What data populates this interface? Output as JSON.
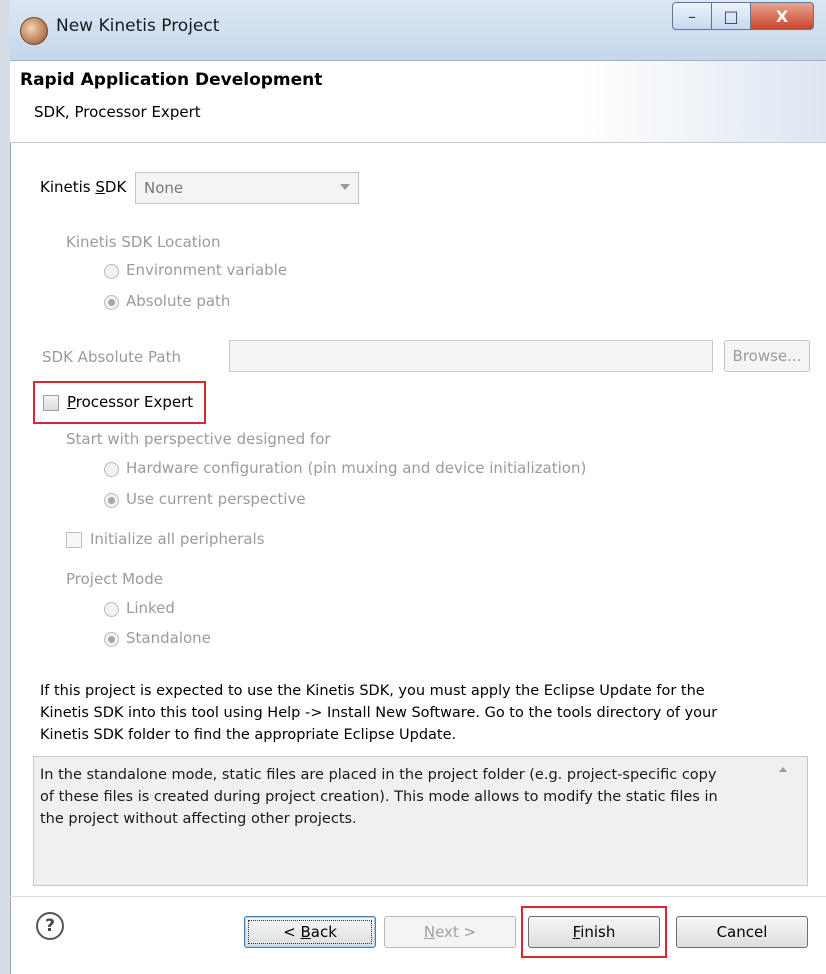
{
  "window": {
    "title": "New Kinetis Project",
    "controls": {
      "minimize": "–",
      "maximize": "□",
      "close": "X"
    }
  },
  "header": {
    "title": "Rapid Application Development",
    "subtitle": "SDK, Processor Expert"
  },
  "sdk": {
    "label_prefix": "Kinetis ",
    "label_mnemonic": "S",
    "label_suffix": "DK",
    "selected": "None",
    "location_label": "Kinetis SDK Location",
    "location_options": [
      {
        "label": "Environment variable",
        "selected": false
      },
      {
        "label": "Absolute path",
        "selected": true
      }
    ],
    "path_label": "SDK Absolute Path",
    "path_value": "",
    "browse_label": "Browse..."
  },
  "processor_expert": {
    "mnemonic": "P",
    "label_rest": "rocessor Expert",
    "checked": false,
    "perspective_label": "Start with perspective designed for",
    "perspective_options": [
      {
        "label": "Hardware configuration (pin muxing and device initialization)",
        "selected": false
      },
      {
        "label": "Use current perspective",
        "selected": true
      }
    ],
    "init_peripherals_label": "Initialize all peripherals",
    "init_peripherals_checked": false,
    "mode_label": "Project Mode",
    "mode_options": [
      {
        "label": "Linked",
        "selected": false
      },
      {
        "label": "Standalone",
        "selected": true
      }
    ]
  },
  "notice": {
    "line1": "If this project is expected to use the Kinetis SDK, you must apply the Eclipse Update for the",
    "line2": "Kinetis SDK into this tool using Help -> Install New Software. Go to the tools directory of your",
    "line3": "Kinetis SDK folder to find the appropriate Eclipse Update."
  },
  "info": {
    "line1": "In the standalone mode, static files are placed in the project folder (e.g.  project-specific copy",
    "line2": "of these files is created during project creation). This mode allows to modify the static files in",
    "line3": "the project without affecting other projects."
  },
  "footer": {
    "help": "?",
    "back_lt": "< ",
    "back_mnemonic": "B",
    "back_rest": "ack",
    "next_mnemonic": "N",
    "next_rest": "ext >",
    "finish_mnemonic": "F",
    "finish_rest": "inish",
    "cancel": "Cancel"
  },
  "colors": {
    "highlight": "#e0262d",
    "titlebar": "#c6d7ec"
  }
}
